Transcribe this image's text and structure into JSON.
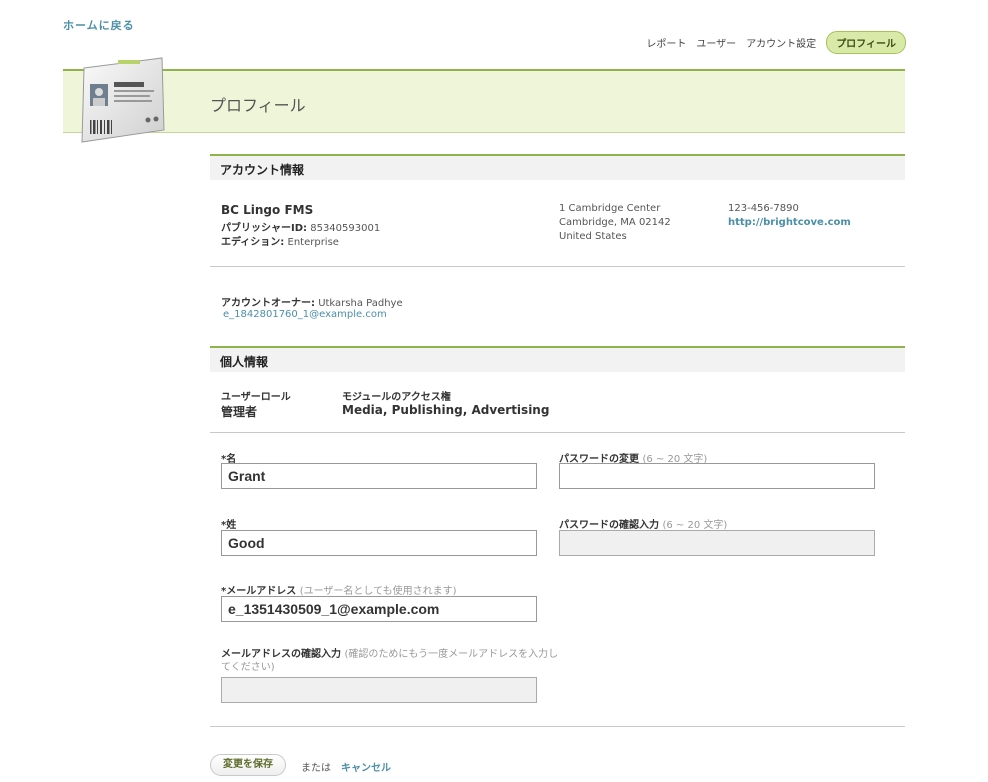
{
  "back_home": "ホームに戻る",
  "nav": {
    "items": [
      "レポート",
      "ユーザー",
      "アカウント設定"
    ],
    "active": "プロフィール"
  },
  "page_title": "プロフィール",
  "account_section": {
    "title": "アカウント情報",
    "name": "BC Lingo FMS",
    "publisher_id_label": "パブリッシャーID:",
    "publisher_id": "85340593001",
    "edition_label": "エディション:",
    "edition": "Enterprise",
    "address_line1": "1 Cambridge Center",
    "address_line2": "Cambridge, MA 02142",
    "address_line3": "United States",
    "phone": "123-456-7890",
    "website": "http://brightcove.com",
    "owner_label": "アカウントオーナー:",
    "owner_name": "Utkarsha Padhye",
    "owner_email": "e_1842801760_1@example.com"
  },
  "personal_section": {
    "title": "個人情報",
    "role_label": "ユーザーロール",
    "role_value": "管理者",
    "access_label": "モジュールのアクセス権",
    "access_value": "Media, Publishing, Advertising"
  },
  "form": {
    "first_name_label": "名",
    "first_name_value": "Grant",
    "last_name_label": "姓",
    "last_name_value": "Good",
    "email_label": "メールアドレス",
    "email_hint": "(ユーザー名としても使用されます)",
    "email_value": "e_1351430509_1@example.com",
    "email_confirm_label": "メールアドレスの確認入力",
    "email_confirm_hint": "(確認のためにもう一度メールアドレスを入力してください)",
    "email_confirm_value": "",
    "password_label": "パスワードの変更",
    "password_hint": "(6 ~ 20 文字)",
    "password_value": "",
    "password_confirm_label": "パスワードの確認入力",
    "password_confirm_hint": "(6 ~ 20 文字)",
    "password_confirm_value": "",
    "required_mark": "*"
  },
  "actions": {
    "save": "変更を保存",
    "or": "または",
    "cancel": "キャンセル"
  },
  "colors": {
    "accent_green": "#8fb34a",
    "banner_bg": "#eef5d9",
    "link": "#4a8fa8"
  }
}
